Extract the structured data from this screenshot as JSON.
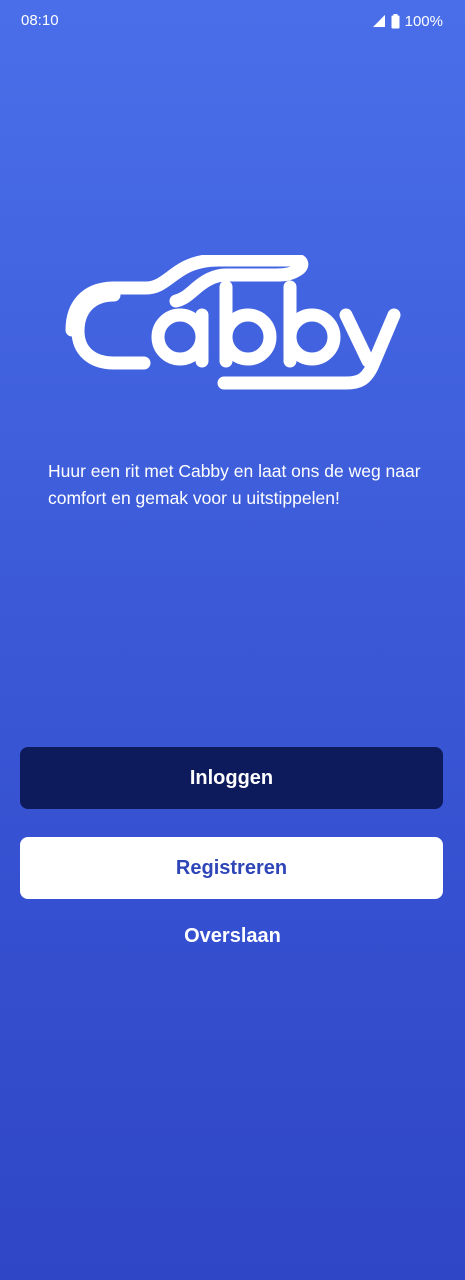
{
  "status_bar": {
    "time": "08:10",
    "battery": "100%",
    "icons": [
      "signal-icon",
      "battery-icon"
    ]
  },
  "logo": {
    "text": "Cabby"
  },
  "tagline": "Huur een rit met Cabby en laat ons de weg naar comfort en gemak voor u uitstippelen!",
  "actions": {
    "login_label": "Inloggen",
    "register_label": "Registreren",
    "skip_label": "Overslaan"
  },
  "colors": {
    "background_top": "#4a6ee9",
    "background_bottom": "#2f47c6",
    "login_button": "#0d1a5c",
    "register_button": "#ffffff",
    "register_text": "#2e46b8"
  }
}
